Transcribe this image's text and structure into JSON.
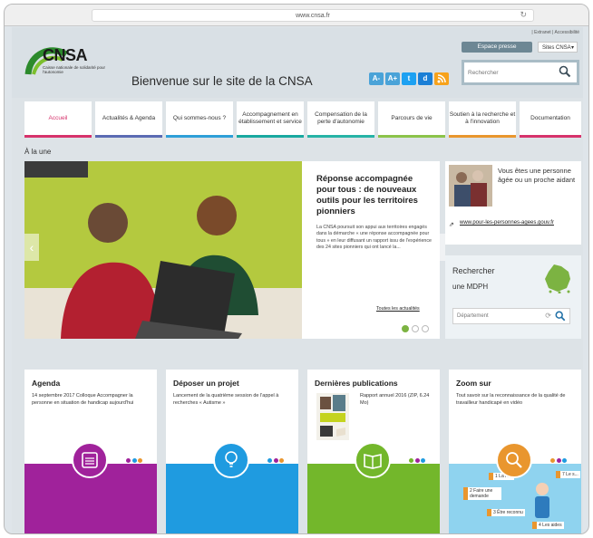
{
  "browser": {
    "url": "www.cnsa.fr"
  },
  "header": {
    "top_links": "| Extranet | Accessibilité",
    "espace_presse": "Espace presse",
    "sites_cnsa": "Sites CNSA",
    "logo_text": "CNSA",
    "logo_subtitle": "Caisse nationale de solidarité pour l'autonomie",
    "welcome": "Bienvenue sur le site de la CNSA",
    "social": [
      {
        "label": "A-",
        "color": "#4aa3d8"
      },
      {
        "label": "A+",
        "color": "#4aa3d8"
      },
      {
        "label": "t",
        "color": "#1da1f2"
      },
      {
        "label": "d",
        "color": "#1b7fd6"
      },
      {
        "label": "rss",
        "color": "#f7a21b"
      }
    ],
    "search_placeholder": "Rechercher"
  },
  "nav": [
    {
      "label": "Accueil",
      "color": "#d6336c"
    },
    {
      "label": "Actualités & Agenda",
      "color": "#5b6bb3"
    },
    {
      "label": "Qui sommes-nous ?",
      "color": "#2f9fd8"
    },
    {
      "label": "Accompagnement en établissement et service",
      "color": "#19a8a0"
    },
    {
      "label": "Compensation de la perte d'autonomie",
      "color": "#27b3a6"
    },
    {
      "label": "Parcours de vie",
      "color": "#8bc34a"
    },
    {
      "label": "Soutien à la recherche et à l'innovation",
      "color": "#e9962e"
    },
    {
      "label": "Documentation",
      "color": "#d6336c"
    }
  ],
  "alaune": "À la une",
  "hero": {
    "title": "Réponse accompagnée pour tous : de nouveaux outils pour les territoires pionniers",
    "body": "La CNSA poursuit son appui aux territoires engagés dans la démarche « une réponse accompagnée pour tous » en leur diffusant un rapport issu de l'expérience des 24 sites pionniers qui ont lancé la...",
    "link": "Toutes les actualités",
    "prev": "‹",
    "next": "›"
  },
  "side": {
    "box1_text": "Vous êtes une personne âgée ou un proche aidant",
    "box1_link": "www.pour-les-personnes-agees.gouv.fr",
    "box2_title": "Rechercher",
    "box2_subtitle": "une MDPH",
    "dept_placeholder": "Département"
  },
  "cards": [
    {
      "title": "Agenda",
      "text": "14 septembre 2017 Colloque Accompagner la personne en situation de handicap aujourd'hui",
      "band": "#a0229b"
    },
    {
      "title": "Déposer un projet",
      "text": "Lancement de la quatrième session de l'appel à recherches « Autisme »",
      "band": "#1f9be0"
    },
    {
      "title": "Dernières publications",
      "text": "Rapport annuel 2016 (ZIP, 6.24 Mo)",
      "band": "#73b72b"
    },
    {
      "title": "Zoom sur",
      "text": "Tout savoir sur la reconnaissance de la qualité de travailleur handicapé en vidéo",
      "band": "#e9962e"
    }
  ],
  "zoom_labels": [
    "1 La R...",
    "2 Faire une demande",
    "3 Être reconnu",
    "4 Les aides",
    "7 Le s..."
  ]
}
